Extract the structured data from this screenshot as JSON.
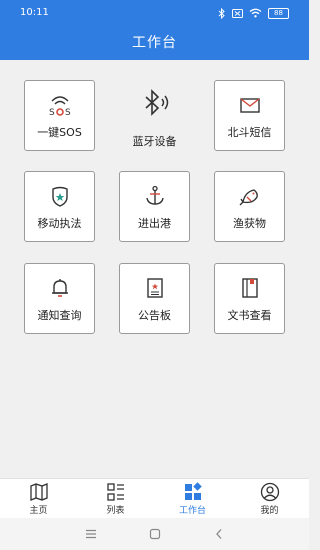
{
  "status": {
    "time": "10:11",
    "battery": "88"
  },
  "header": {
    "title": "工作台"
  },
  "tiles": [
    {
      "label": "一键SOS",
      "icon": "sos-signal-icon"
    },
    {
      "label": "蓝牙设备",
      "icon": "bluetooth-icon"
    },
    {
      "label": "北斗短信",
      "icon": "envelope-icon"
    },
    {
      "label": "移动执法",
      "icon": "badge-icon"
    },
    {
      "label": "进出港",
      "icon": "anchor-icon"
    },
    {
      "label": "渔获物",
      "icon": "fish-icon"
    },
    {
      "label": "通知查询",
      "icon": "bell-icon"
    },
    {
      "label": "公告板",
      "icon": "notice-board-icon"
    },
    {
      "label": "文书查看",
      "icon": "document-icon"
    }
  ],
  "tabs": [
    {
      "label": "主页",
      "icon": "map-icon",
      "active": false
    },
    {
      "label": "列表",
      "icon": "list-icon",
      "active": false
    },
    {
      "label": "工作台",
      "icon": "workbench-icon",
      "active": true
    },
    {
      "label": "我的",
      "icon": "user-icon",
      "active": false
    }
  ],
  "colors": {
    "primary": "#2f7de1",
    "accent_red": "#d24a3a",
    "accent_green": "#2a9d8f"
  }
}
